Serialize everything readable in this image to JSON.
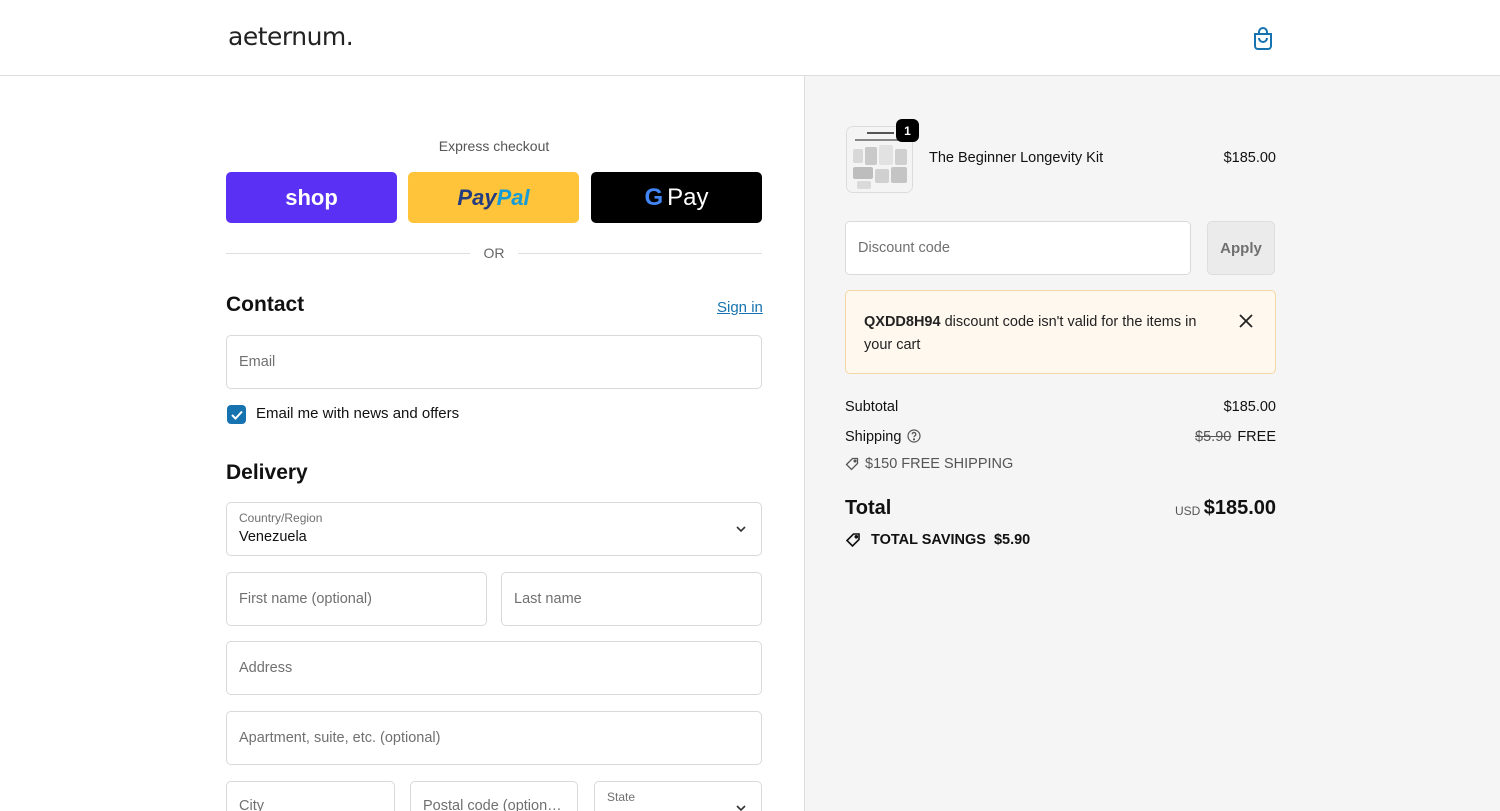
{
  "header": {
    "logo": "aeternum.",
    "cart_icon": "shopping-bag-icon"
  },
  "express": {
    "title": "Express checkout",
    "shop_label": "shop",
    "paypal_label_1": "Pay",
    "paypal_label_2": "Pal",
    "gpay_g": "G",
    "gpay_label": "Pay",
    "or": "OR"
  },
  "contact": {
    "title": "Contact",
    "signin": "Sign in",
    "email_placeholder": "Email",
    "newsletter_label": "Email me with news and offers",
    "newsletter_checked": true
  },
  "delivery": {
    "title": "Delivery",
    "country_label": "Country/Region",
    "country_value": "Venezuela",
    "first_name_placeholder": "First name (optional)",
    "last_name_placeholder": "Last name",
    "address_placeholder": "Address",
    "apartment_placeholder": "Apartment, suite, etc. (optional)",
    "city_placeholder": "City",
    "postal_placeholder": "Postal code (option…",
    "state_label": "State"
  },
  "summary": {
    "product_name": "The Beginner Longevity Kit",
    "product_price": "$185.00",
    "quantity": "1",
    "discount_placeholder": "Discount code",
    "apply_label": "Apply",
    "alert_code": "QXDD8H94",
    "alert_message": " discount code isn't valid for the items in your cart",
    "subtotal_label": "Subtotal",
    "subtotal_value": "$185.00",
    "shipping_label": "Shipping",
    "shipping_old": "$5.90",
    "shipping_value": "FREE",
    "promo_label": "$150 FREE SHIPPING",
    "total_label": "Total",
    "total_currency": "USD",
    "total_value": "$185.00",
    "savings_label": "TOTAL SAVINGS",
    "savings_value": "$5.90"
  },
  "colors": {
    "shop": "#5a31f4",
    "paypal": "#ffc439",
    "gpay": "#000000",
    "link": "#1773b0",
    "alert_bg": "#fff8ee"
  }
}
